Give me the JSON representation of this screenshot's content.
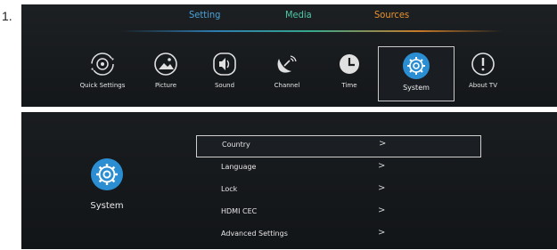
{
  "step_number": "1.",
  "top_tabs": [
    "Setting",
    "Media",
    "Sources"
  ],
  "menu": {
    "quick_settings": "Quick Settings",
    "picture": "Picture",
    "sound": "Sound",
    "channel": "Channel",
    "time": "Time",
    "system": "System",
    "about": "About TV"
  },
  "system_panel": {
    "title": "System",
    "items": [
      {
        "label": "Country",
        "arrow": ">"
      },
      {
        "label": "Language",
        "arrow": ">"
      },
      {
        "label": "Lock",
        "arrow": ">"
      },
      {
        "label": "HDMI CEC",
        "arrow": ">"
      },
      {
        "label": "Advanced Settings",
        "arrow": ">"
      }
    ]
  },
  "colors": {
    "accent_blue": "#2b8ed2",
    "tab_setting": "#4aa2d8",
    "tab_media": "#4ec8a8",
    "tab_sources": "#e9932d",
    "panel_bg": "#1a1d20"
  },
  "icons": [
    "quick-settings-icon",
    "picture-icon",
    "sound-icon",
    "channel-icon",
    "time-icon",
    "system-gear-icon",
    "about-info-icon"
  ]
}
